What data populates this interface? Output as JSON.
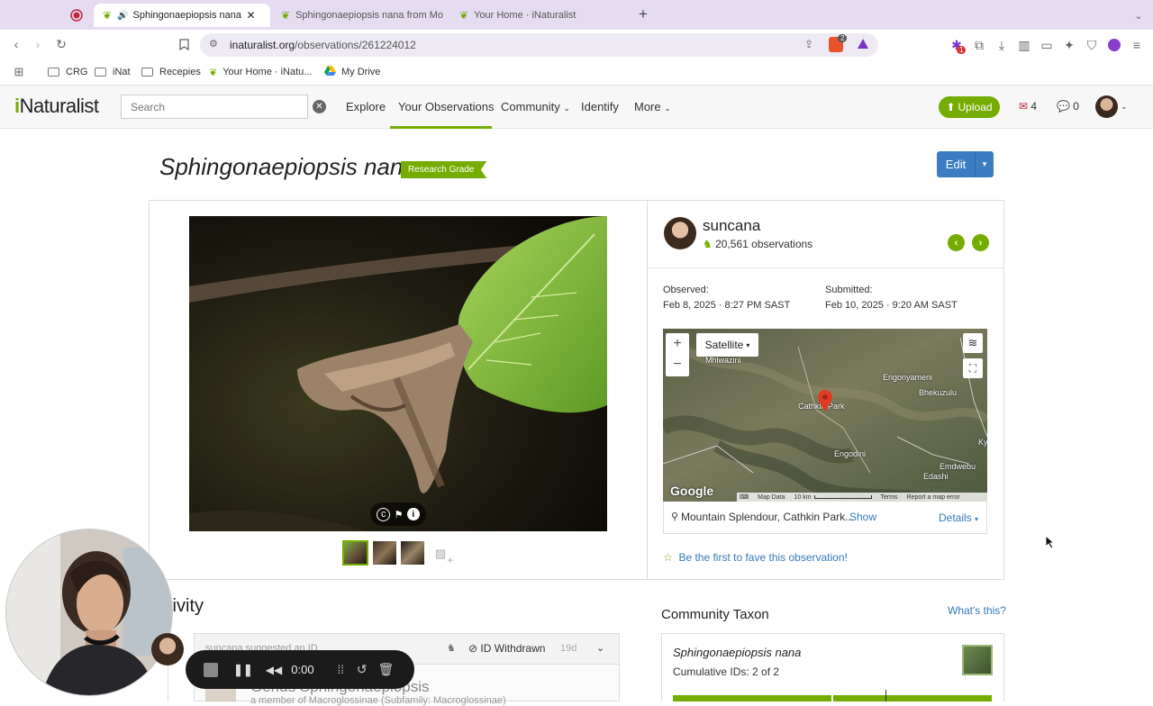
{
  "browser": {
    "tabs": [
      {
        "title": "Sphingonaepiopsis nana fr",
        "active": true
      },
      {
        "title": "Sphingonaepiopsis nana from Mo",
        "active": false
      },
      {
        "title": "Your Home · iNaturalist",
        "active": false
      }
    ],
    "new_tab": "+",
    "url_domain": "inaturalist.org",
    "url_path": "/observations/261224012",
    "bookmarks": [
      "CRG",
      "iNat",
      "Recepies",
      "Your Home · iNatu...",
      "My Drive"
    ],
    "ext_badge_count": "1",
    "shield_count": "2"
  },
  "nav": {
    "logo": "iNaturalist",
    "search_placeholder": "Search",
    "links": [
      "Explore",
      "Your Observations",
      "Community",
      "Identify",
      "More"
    ],
    "upload": "Upload",
    "messages_count": "4",
    "notifications_count": "0"
  },
  "observation": {
    "title": "Sphingonaepiopsis nana",
    "grade": "Research Grade",
    "edit": "Edit",
    "user": "suncana",
    "obs_count": "20,561 observations",
    "observed_label": "Observed:",
    "observed_value": "Feb 8, 2025 · 8:27 PM SAST",
    "submitted_label": "Submitted:",
    "submitted_value": "Feb 10, 2025 · 9:20 AM SAST",
    "location": "Mountain Splendour, Cathkin Park...",
    "show": "Show",
    "details": "Details",
    "fave": "Be the first to fave this observation!"
  },
  "map": {
    "mode": "Satellite",
    "zoom_in": "+",
    "zoom_out": "−",
    "labels": [
      "Mhlwazini",
      "Engonyameni",
      "Bhekuzulu",
      "Cathkin Park",
      "Engodini",
      "Emdwebu",
      "Edashi",
      "Ky"
    ],
    "google": "Google",
    "map_data": "Map Data",
    "scale": "10 km",
    "terms": "Terms",
    "report": "Report a map error"
  },
  "activity": {
    "heading": "tivity",
    "row_user": "suncana suggested an ID",
    "withdrawn": "ID Withdrawn",
    "age": "19d",
    "genus": "Genus Sphingonaepiopsis",
    "member": "a member of Macroglossinae (Subfamily: Macroglossinae)"
  },
  "community": {
    "heading": "Community Taxon",
    "whats_this": "What's this?",
    "taxon": "Sphingonaepiopsis nana",
    "cumulative": "Cumulative IDs: 2 of 2",
    "agreement": 1.0
  },
  "recorder": {
    "time": "0:00"
  },
  "colors": {
    "brand_green": "#74ac00",
    "link": "#337ab7",
    "edit_blue": "#3a7ec1",
    "tab_bg": "#e6dcf2"
  }
}
